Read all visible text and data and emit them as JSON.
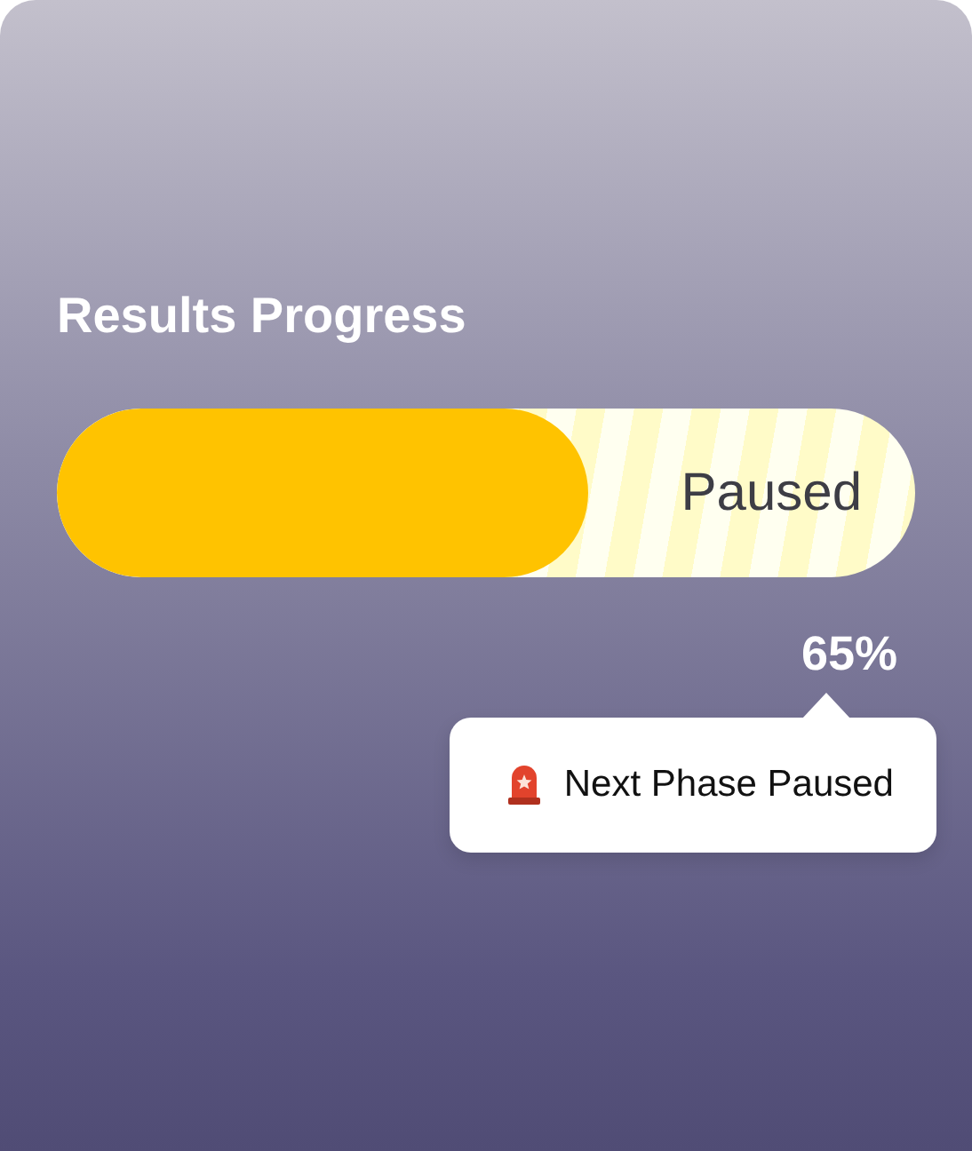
{
  "title": "Results Progress",
  "progress": {
    "level": 0.62,
    "status": "Paused",
    "percent": "65%"
  },
  "tooltip": {
    "text": "Next Phase Paused"
  }
}
